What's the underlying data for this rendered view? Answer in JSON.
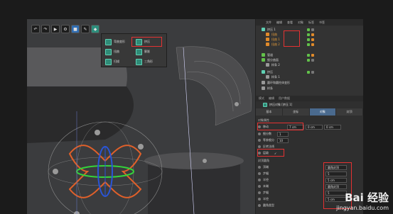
{
  "toolbar": {
    "icons": [
      "undo-icon",
      "redo-icon",
      "render-icon",
      "cube-icon",
      "pen-icon",
      "deformer-icon"
    ]
  },
  "popup": {
    "items": [
      {
        "label": "弯曲变形",
        "icon": "bend-icon"
      },
      {
        "label": "挤压",
        "icon": "squash-icon"
      },
      {
        "label": "扭曲",
        "icon": "twist-icon"
      },
      {
        "label": "膨胀",
        "icon": "bulge-icon"
      },
      {
        "label": "扫描",
        "icon": "shear-icon"
      },
      {
        "label": "三角形",
        "icon": "taper-icon"
      }
    ]
  },
  "object_manager": {
    "menu": [
      "文件",
      "编辑",
      "查看",
      "对象",
      "标签",
      "书签"
    ],
    "objects": [
      {
        "label": "挤压 1",
        "color": "#5fd1b4",
        "highlight": true
      },
      {
        "label": "扭曲",
        "color": "#e08a2a"
      },
      {
        "label": "扭曲 1",
        "color": "#e08a2a"
      },
      {
        "label": "扭曲 2",
        "color": "#e08a2a"
      },
      {
        "label": "管道",
        "color": "#62c24a"
      },
      {
        "label": "细分曲面",
        "color": "#62c24a"
      },
      {
        "label": "样条 2",
        "color": "#999999"
      },
      {
        "label": "挤压",
        "color": "#5fd1b4"
      },
      {
        "label": "样条 1",
        "color": "#999999"
      },
      {
        "label": "圆环和圆柱体变形",
        "color": "#999999"
      },
      {
        "label": "样条",
        "color": "#999999"
      }
    ]
  },
  "attributes": {
    "menu": [
      "模式",
      "编辑",
      "用户数据"
    ],
    "title": "挤压对象 [挤压 1]",
    "tabs": [
      "基本",
      "坐标",
      "对象",
      "封顶"
    ],
    "active_tab": "对象",
    "section_title": "对象属性",
    "props": [
      {
        "label": "移动",
        "v1": "7 cm",
        "v2": "0 cm",
        "v3": "0 cm"
      },
      {
        "label": "细分数",
        "v1": "1"
      },
      {
        "label": "等参细分",
        "v1": "10"
      },
      {
        "label": "反转法线",
        "v1": ""
      },
      {
        "label": "层级",
        "v1": "✓"
      }
    ],
    "section2_title": "封顶圆角",
    "caps": [
      {
        "label": "顶端",
        "value": "圆角封顶"
      },
      {
        "label": "步幅",
        "value": "5"
      },
      {
        "label": "半径",
        "value": "5 cm"
      },
      {
        "label": "末端",
        "value": "圆角封顶"
      },
      {
        "label": "步幅",
        "value": "5"
      },
      {
        "label": "半径",
        "value": "5 cm"
      },
      {
        "label": "圆角类型",
        "value": ""
      }
    ]
  },
  "watermark": {
    "logo": "Bai 经验",
    "url": "jingyan.baidu.com"
  }
}
